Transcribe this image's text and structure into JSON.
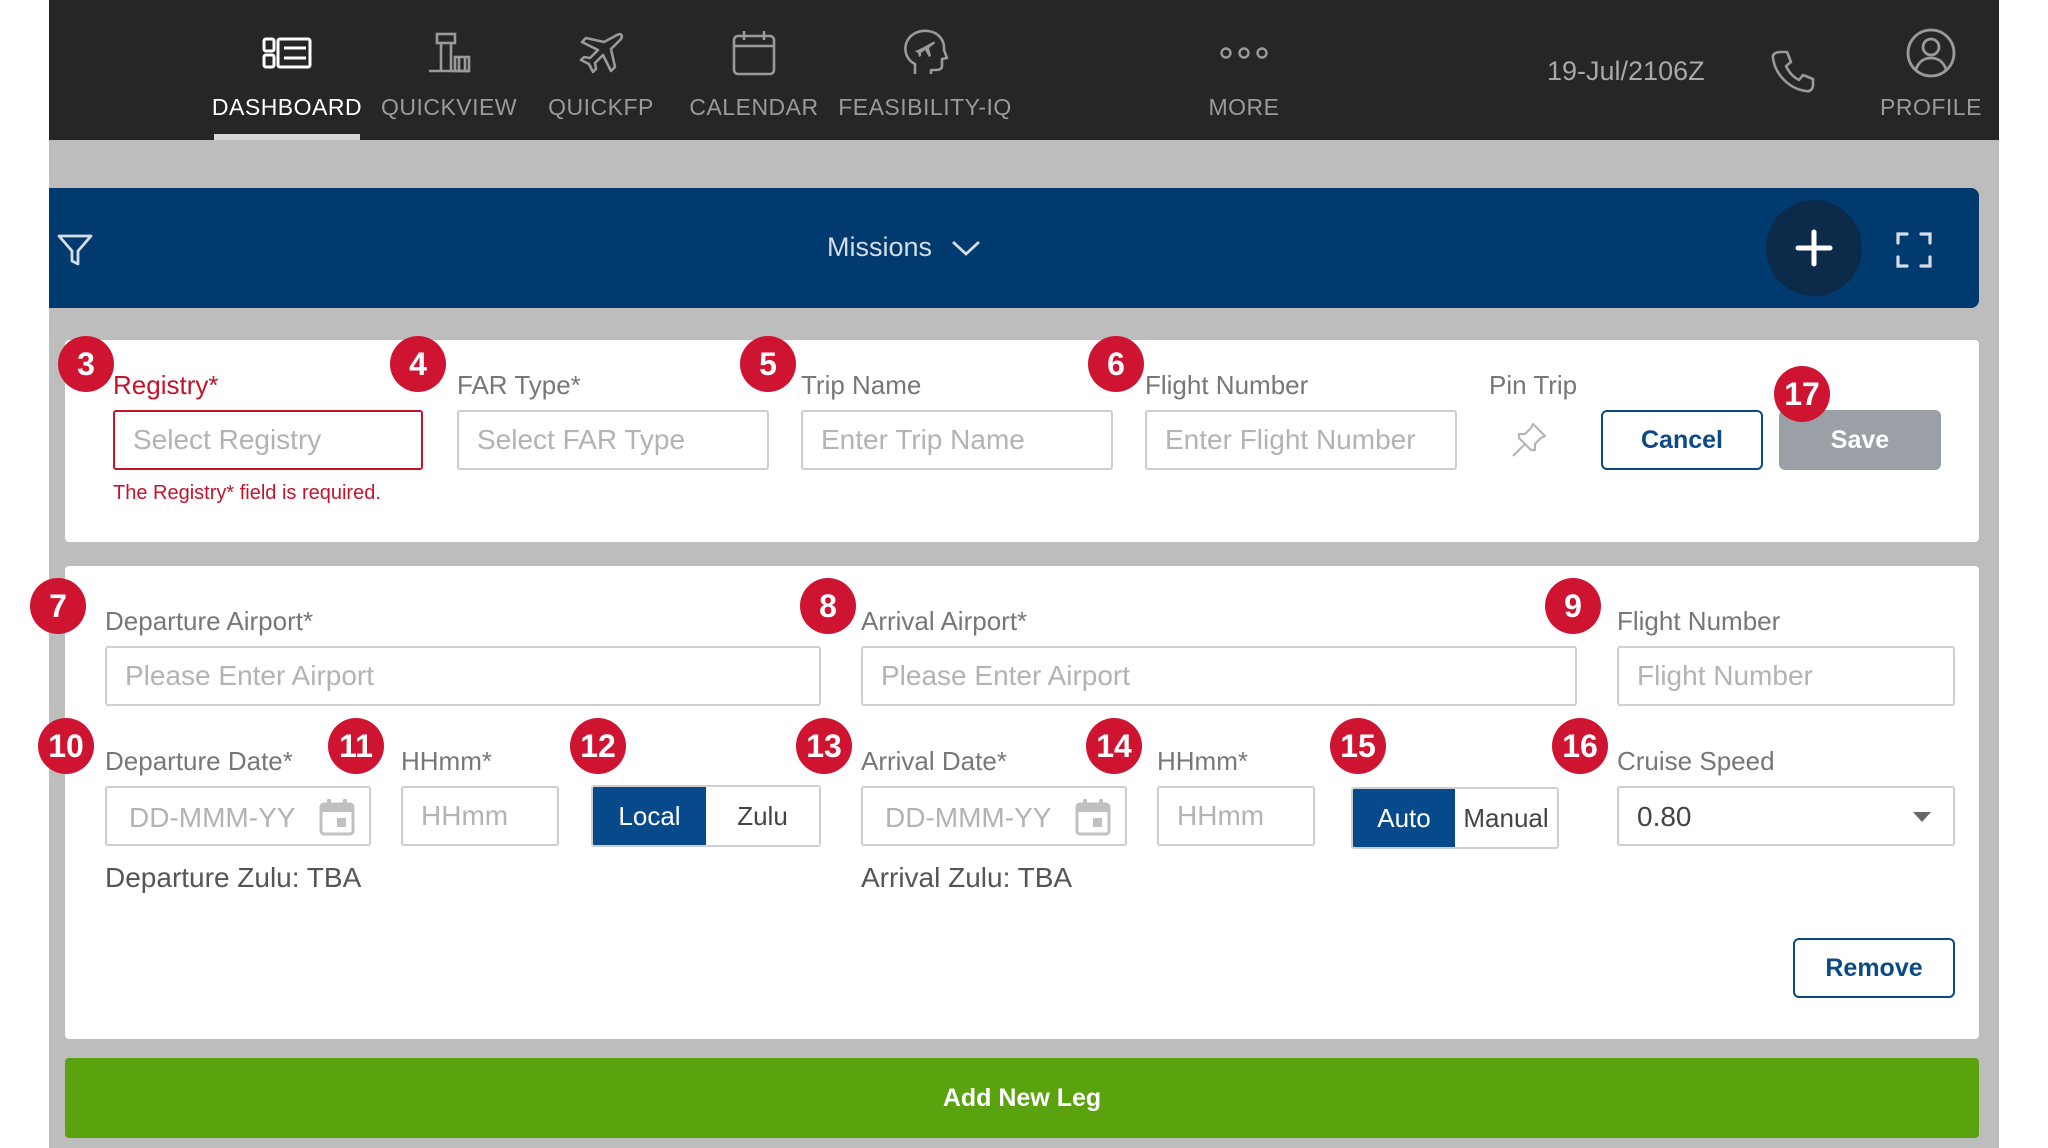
{
  "nav": {
    "items": [
      {
        "label": "DASHBOARD",
        "icon": "dashboard-icon",
        "active": true
      },
      {
        "label": "QUICKVIEW",
        "icon": "airport-tower-icon"
      },
      {
        "label": "QUICKFP",
        "icon": "airplane-icon"
      },
      {
        "label": "CALENDAR",
        "icon": "calendar-icon"
      },
      {
        "label": "FEASIBILITY-IQ",
        "icon": "head-airplane-icon"
      },
      {
        "label": "MORE",
        "icon": "more-dots-icon"
      }
    ],
    "datetime": "19-Jul/2106Z",
    "phone_icon": "phone-icon",
    "profile_label": "PROFILE",
    "profile_icon": "profile-icon"
  },
  "mission_bar": {
    "title": "Missions",
    "filter_icon": "filter-icon",
    "add_icon": "plus-icon",
    "expand_icon": "expand-icon",
    "color": "#003a6e"
  },
  "trip": {
    "registry_label": "Registry*",
    "registry_placeholder": "Select Registry",
    "registry_error": "The Registry* field is required.",
    "far_label": "FAR Type*",
    "far_placeholder": "Select FAR Type",
    "trip_name_label": "Trip Name",
    "trip_name_placeholder": "Enter Trip Name",
    "flight_number_label": "Flight Number",
    "flight_number_placeholder": "Enter Flight Number",
    "pin_label": "Pin Trip",
    "pin_icon": "pin-icon",
    "cancel_label": "Cancel",
    "save_label": "Save"
  },
  "leg": {
    "departure_airport_label": "Departure Airport*",
    "departure_airport_placeholder": "Please Enter Airport",
    "arrival_airport_label": "Arrival Airport*",
    "arrival_airport_placeholder": "Please Enter Airport",
    "flight_number_label": "Flight Number",
    "flight_number_placeholder": "Flight Number",
    "departure_date_label": "Departure Date*",
    "departure_date_placeholder": "DD-MMM-YY",
    "departure_time_label": "HHmm*",
    "departure_time_placeholder": "HHmm",
    "time_mode_options": [
      "Local",
      "Zulu"
    ],
    "time_mode_selected": "Local",
    "arrival_date_label": "Arrival Date*",
    "arrival_date_placeholder": "DD-MMM-YY",
    "arrival_time_label": "HHmm*",
    "arrival_time_placeholder": "HHmm",
    "calc_mode_options": [
      "Auto",
      "Manual"
    ],
    "calc_mode_selected": "Auto",
    "cruise_speed_label": "Cruise Speed",
    "cruise_speed_value": "0.80",
    "departure_zulu": "Departure Zulu: TBA",
    "arrival_zulu": "Arrival Zulu: TBA",
    "remove_label": "Remove"
  },
  "add_leg_label": "Add New Leg",
  "badges": [
    "3",
    "4",
    "5",
    "6",
    "17",
    "7",
    "8",
    "9",
    "10",
    "11",
    "12",
    "13",
    "14",
    "15",
    "16"
  ],
  "colors": {
    "accent": "#064a8c",
    "error": "#c4142c",
    "badge": "#cf1431",
    "add_leg": "#5aa30e",
    "save_disabled": "#9ba0a6"
  }
}
